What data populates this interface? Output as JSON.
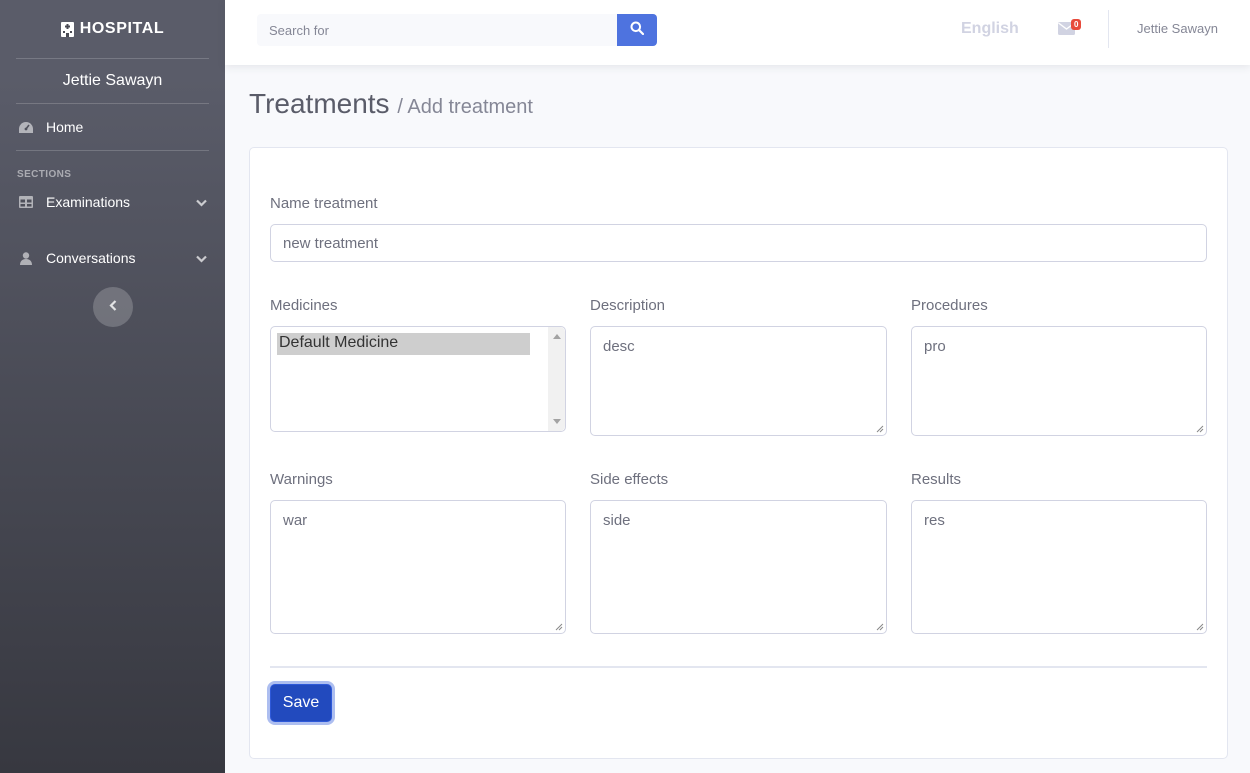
{
  "sidebar": {
    "brand": "HOSPITAL",
    "user": "Jettie Sawayn",
    "home_label": "Home",
    "section_heading": "SECTIONS",
    "items": [
      {
        "label": "Examinations",
        "icon": "table-icon"
      },
      {
        "label": "Conversations",
        "icon": "user-icon"
      }
    ]
  },
  "topbar": {
    "search_placeholder": "Search for",
    "language": "English",
    "mail_count": "0",
    "user": "Jettie Sawayn"
  },
  "page": {
    "title": "Treatments",
    "subtitle": "/ Add treatment"
  },
  "form": {
    "name_label": "Name treatment",
    "name_value": "new treatment",
    "medicines_label": "Medicines",
    "medicines_options": [
      "Default Medicine"
    ],
    "description_label": "Description",
    "description_value": "desc",
    "procedures_label": "Procedures",
    "procedures_value": "pro",
    "warnings_label": "Warnings",
    "warnings_value": "war",
    "side_effects_label": "Side effects",
    "side_effects_value": "side",
    "results_label": "Results",
    "results_value": "res",
    "save_label": "Save"
  },
  "colors": {
    "primary": "#4e73df",
    "save_button": "#224abe",
    "badge": "#e74a3b",
    "sidebar_top": "#5a5c69",
    "sidebar_bottom": "#373840"
  }
}
